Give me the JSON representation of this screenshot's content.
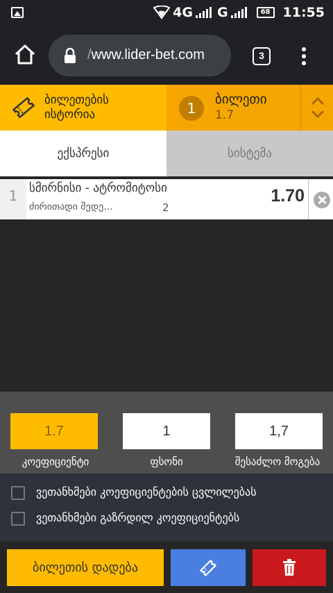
{
  "status_bar": {
    "network_1": "4G",
    "network_2": "G",
    "battery": "68",
    "time": "11:55"
  },
  "browser": {
    "url_prefix": "/",
    "url_host": "www.lider-bet.com",
    "tab_count": "3"
  },
  "header": {
    "history_line1": "ბილეთების",
    "history_line2": "ისტორია",
    "slip_count": "1",
    "slip_title": "ბილეთი",
    "slip_odds": "1.7"
  },
  "mode_tabs": {
    "express": "ექსპრესი",
    "system": "სისტემა"
  },
  "bet": {
    "index": "1",
    "event": "სმირნისი - ატრომიტოსი",
    "market": "ძირითადი შედე...",
    "outcome": "2",
    "odds": "1.70"
  },
  "summary": {
    "odds_value": "1.7",
    "stake_value": "1",
    "win_value": "1,7",
    "odds_label": "კოეფიციენტი",
    "stake_label": "ფსონი",
    "win_label": "შესაძლო მოგება"
  },
  "options": {
    "accept_changes": "ვეთანხმები კოეფიციენტების ცვლილებას",
    "accept_increased": "ვეთანხმები გაზრდილ კოეფიციენტებს"
  },
  "actions": {
    "place_bet": "ბილეთის დადება"
  },
  "colors": {
    "accent": "#ffbb00",
    "accent_dark": "#f5a600",
    "blue": "#4a7ee0",
    "red": "#c9191c"
  }
}
